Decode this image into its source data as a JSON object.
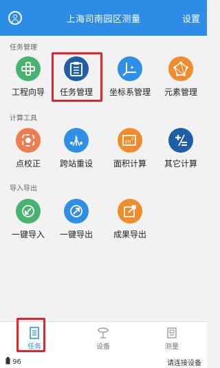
{
  "header": {
    "title": "上海司南园区测量",
    "settings_label": "设置",
    "user_icon": "user-icon"
  },
  "sections": [
    {
      "title": "任务管理",
      "items": [
        {
          "label": "工程向导",
          "icon": "plus-icon",
          "color": "#46b46e"
        },
        {
          "label": "任务管理",
          "icon": "clipboard-icon",
          "color": "#2f8fe6"
        },
        {
          "label": "坐标系管理",
          "icon": "axes-icon",
          "color": "#2f8fe6"
        },
        {
          "label": "元素管理",
          "icon": "network-icon",
          "color": "#f18c2e"
        }
      ]
    },
    {
      "title": "计算工具",
      "items": [
        {
          "label": "点校正",
          "icon": "target-icon",
          "color": "#f18c2e"
        },
        {
          "label": "跨站重设",
          "icon": "station-icon",
          "color": "#2f8fe6"
        },
        {
          "label": "面积计算",
          "icon": "area-icon",
          "color": "#f18c2e"
        },
        {
          "label": "其它计算",
          "icon": "calculator-icon",
          "color": "#2f8fe6"
        }
      ]
    },
    {
      "title": "导入导出",
      "items": [
        {
          "label": "一键导入",
          "icon": "import-icon",
          "color": "#46b46e"
        },
        {
          "label": "一键导出",
          "icon": "export-icon",
          "color": "#2f8fe6"
        },
        {
          "label": "成果导出",
          "icon": "result-export-icon",
          "color": "#f18c2e"
        }
      ]
    }
  ],
  "bottom_nav": [
    {
      "label": "任务",
      "icon": "task-icon",
      "active": true
    },
    {
      "label": "设备",
      "icon": "device-icon",
      "active": false
    },
    {
      "label": "测量",
      "icon": "measure-icon",
      "active": false
    }
  ],
  "status": {
    "battery": "96",
    "connection": "请连接设备"
  },
  "colors": {
    "brand": "#2d8ce6",
    "highlight": "#e3242b"
  }
}
